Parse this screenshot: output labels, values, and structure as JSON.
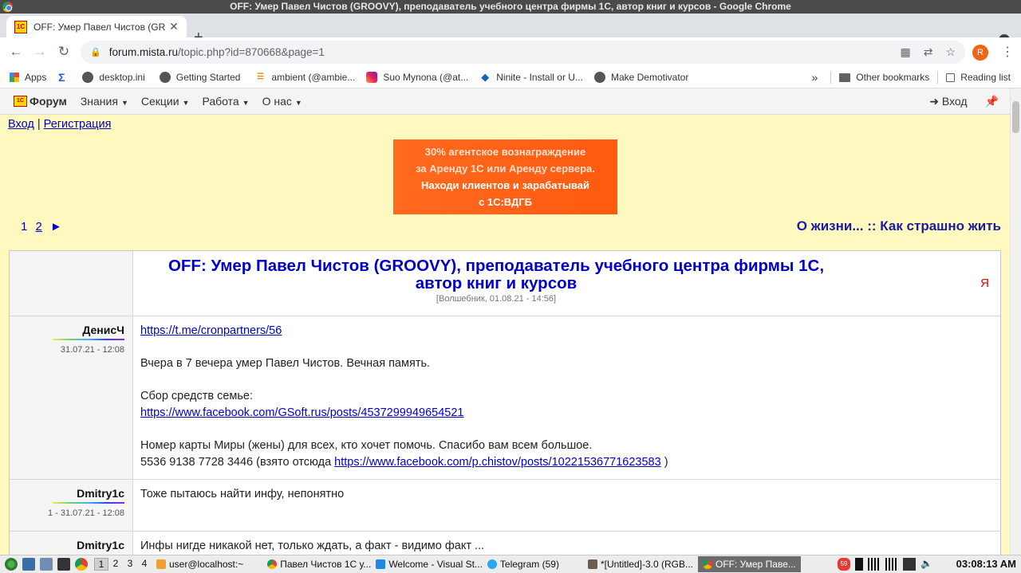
{
  "window": {
    "title": "OFF: Умер Павел Чистов (GROOVY), преподаватель учебного центра фирмы 1С, автор книг и курсов - Google Chrome"
  },
  "tab": {
    "title": "OFF: Умер Павел Чистов (GR",
    "favicon": "1С",
    "close": "✕",
    "new": "+"
  },
  "address": {
    "host": "forum.mista.ru",
    "path": "/topic.php?id=870668&page=1"
  },
  "profile": {
    "initial": "R"
  },
  "bookmarks": {
    "items": [
      {
        "label": "Apps",
        "icon": "apps-grid-icon"
      },
      {
        "label": "",
        "icon": "sigma-icon"
      },
      {
        "label": "desktop.ini",
        "icon": "globe-icon"
      },
      {
        "label": "Getting Started",
        "icon": "globe-icon"
      },
      {
        "label": "ambient (@ambie...",
        "icon": "ambient-icon"
      },
      {
        "label": "Suo Mynona (@at...",
        "icon": "instagram-icon"
      },
      {
        "label": "Ninite - Install or U...",
        "icon": "ninite-icon"
      },
      {
        "label": "Make Demotivator",
        "icon": "globe-icon"
      }
    ],
    "overflow": "»",
    "other": "Other bookmarks",
    "reading": "Reading list"
  },
  "sitenav": {
    "brand": "Форум",
    "items": [
      "Знания",
      "Секции",
      "Работа",
      "О нас"
    ],
    "login": "Вход"
  },
  "auth": {
    "login": "Вход",
    "separator": "|",
    "register": "Регистрация"
  },
  "banner": {
    "line1": "30% агентское вознаграждение",
    "line2": "за Аренду 1С или Аренду сервера.",
    "line3": "Находи клиентов и зарабатывай",
    "line4": "с 1С:ВДГБ"
  },
  "pager": {
    "page1": "1",
    "page2": "2",
    "next": "►"
  },
  "section": {
    "title": "О жизни... :: Как страшно жить"
  },
  "topic": {
    "title": "OFF: Умер Павел Чистов (GROOVY), преподаватель учебного центра фирмы 1С, автор книг и курсов",
    "meta": "[Волшебник, 01.08.21 - 14:56]",
    "ya": "Я"
  },
  "posts": [
    {
      "author": "ДенисЧ",
      "date": "31.07.21 - 12:08",
      "link1": "https://t.me/cronpartners/56",
      "text1": "Вчера в 7 вечера умер Павел Чистов. Вечная память.",
      "text2": "Сбор средств семье:",
      "link2": "https://www.facebook.com/GSoft.rus/posts/4537299949654521",
      "text3": "Номер карты Миры (жены) для всех, кто хочет помочь. Спасибо вам всем большое.",
      "text4": "5536 9138 7728 3446 (взято отсюда ",
      "link3": "https://www.facebook.com/p.chistov/posts/10221536771623583",
      "text5": " )"
    },
    {
      "author": "Dmitry1c",
      "date": "1 - 31.07.21 - 12:08",
      "text": "Тоже пытаюсь найти инфу, непонятно"
    },
    {
      "author": "Dmitry1c",
      "date": "",
      "text": "Инфы нигде никакой нет, только ждать, а факт - видимо факт ..."
    }
  ],
  "taskbar": {
    "desktops": [
      "1",
      "2",
      "3",
      "4"
    ],
    "tasks": [
      "user@localhost:~",
      "Павел Чистов 1С у...",
      "Welcome - Visual St...",
      "Telegram (59)",
      "*[Untitled]-3.0 (RGB...",
      "OFF: Умер Паве..."
    ],
    "badge": "59",
    "clock": "03:08:13 AM"
  }
}
